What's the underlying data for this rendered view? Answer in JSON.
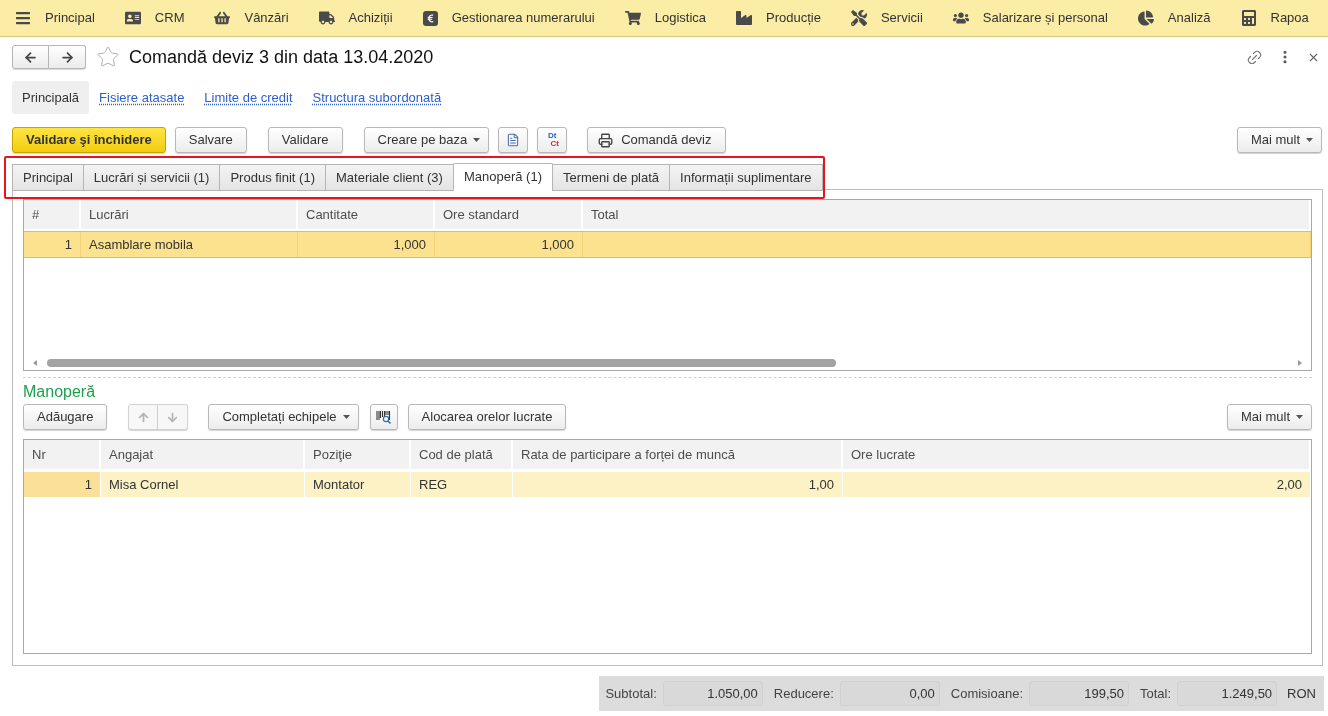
{
  "main_menu": [
    {
      "label": "Principal"
    },
    {
      "label": "CRM"
    },
    {
      "label": "Vânzări"
    },
    {
      "label": "Achiziții"
    },
    {
      "label": "Gestionarea numerarului"
    },
    {
      "label": "Logistica"
    },
    {
      "label": "Producție"
    },
    {
      "label": "Servicii"
    },
    {
      "label": "Salarizare și personal"
    },
    {
      "label": "Analiză"
    },
    {
      "label": "Rapoa"
    }
  ],
  "form": {
    "title": "Comandă deviz 3 din data 13.04.2020",
    "favorite": false
  },
  "sections": [
    {
      "label": "Principală",
      "selected": true
    },
    {
      "label": "Fisiere atasate",
      "selected": false
    },
    {
      "label": "Limite de credit",
      "selected": false
    },
    {
      "label": "Structura subordonată",
      "selected": false
    }
  ],
  "toolbar": {
    "buttons": [
      {
        "kind": "primary",
        "label": "Validare şi închidere"
      },
      {
        "kind": "button",
        "label": "Salvare"
      },
      {
        "kind": "button",
        "label": "Validare"
      },
      {
        "kind": "dropdown",
        "label": "Creare pe baza"
      },
      {
        "kind": "report"
      },
      {
        "kind": "ledger",
        "top": "Dt",
        "bottom": "Ct"
      },
      {
        "kind": "print",
        "label": "Comandă deviz"
      }
    ],
    "more": "Mai mult"
  },
  "tab_strip": {
    "highlighted": true,
    "tabs": [
      {
        "label": "Principal",
        "selected": false
      },
      {
        "label": "Lucrări și servicii (1)",
        "selected": false
      },
      {
        "label": "Produs finit (1)",
        "selected": false
      },
      {
        "label": "Materiale client (3)",
        "selected": false
      },
      {
        "label": "Manoperă (1)",
        "selected": true
      },
      {
        "label": "Termeni de plată",
        "selected": false
      },
      {
        "label": "Informații suplimentare",
        "selected": false
      }
    ]
  },
  "works_table": {
    "focused": true,
    "columns": [
      {
        "label": "#",
        "kind": "number"
      },
      {
        "label": "Lucrări",
        "kind": "text"
      },
      {
        "label": "Cantitate",
        "kind": "number"
      },
      {
        "label": "Ore standard",
        "kind": "number"
      },
      {
        "label": "Total",
        "kind": "number"
      }
    ],
    "rows": [
      {
        "selected": true,
        "cells": [
          "1",
          "Asamblare mobila",
          "1,000",
          "1,000"
        ]
      }
    ]
  },
  "labor": {
    "title": "Manoperă",
    "toolbar": {
      "buttons": [
        {
          "kind": "button",
          "label": "Adăugare"
        },
        {
          "kind": "move",
          "disabled": true
        },
        {
          "kind": "dropdown",
          "label": "Completați echipele"
        },
        {
          "kind": "search"
        },
        {
          "kind": "button",
          "label": "Alocarea orelor lucrate"
        }
      ],
      "more": "Mai mult"
    },
    "table": {
      "focused": false,
      "columns": [
        {
          "label": "Nr",
          "kind": "number"
        },
        {
          "label": "Angajat",
          "kind": "text"
        },
        {
          "label": "Poziţie",
          "kind": "text"
        },
        {
          "label": "Cod de plată",
          "kind": "text"
        },
        {
          "label": "Rata de participare a forței de muncă",
          "kind": "number"
        },
        {
          "label": "Ore lucrate",
          "kind": "number"
        }
      ],
      "rows": [
        {
          "selected": true,
          "cells": [
            "1",
            "Misa Cornel",
            "Montator",
            "REG",
            "1,00",
            "2,00"
          ]
        }
      ]
    }
  },
  "totals": {
    "items": [
      {
        "label": "Subtotal:",
        "value": "1.050,00"
      },
      {
        "label": "Reducere:",
        "value": "0,00"
      },
      {
        "label": "Comisioane:",
        "value": "199,50"
      },
      {
        "label": "Total:",
        "value": "1.249,50"
      }
    ],
    "currency": "RON"
  }
}
